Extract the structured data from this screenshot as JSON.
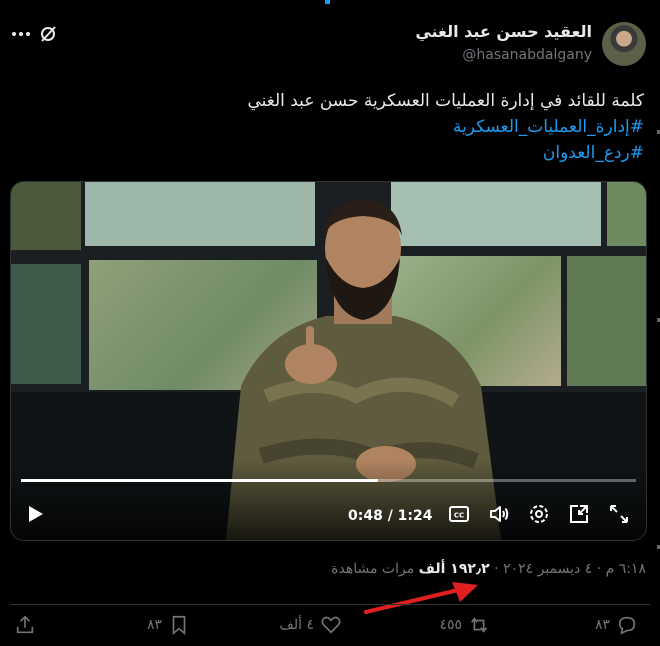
{
  "author": {
    "display_name": "العقيد حسن عبد الغني",
    "handle": "@hasanabdalgany"
  },
  "tweet": {
    "text": "كلمة للقائد في إدارة العمليات العسكرية حسن عبد الغني",
    "hashtags": [
      "#إدارة_العمليات_العسكرية",
      "#ردع_العدوان"
    ]
  },
  "video": {
    "time_display": "0:48 / 1:24",
    "progress_fraction": 0.58
  },
  "meta": {
    "timestamp": "٦:١٨ م · ٤ ديسمبر ٢٠٢٤ ·",
    "views_count": "١٩٢٫٢ ألف",
    "views_label": "مرات مشاهدة"
  },
  "actions": {
    "replies": "٨٣",
    "reposts": "٤٥٥",
    "likes": "٤ ألف",
    "bookmarks": "٨٣"
  },
  "colors": {
    "accent": "#1d9bf0",
    "muted": "#71767b",
    "arrow": "#e02020"
  },
  "icons": [
    "grok-icon",
    "more-icon",
    "play-icon",
    "captions-icon",
    "volume-icon",
    "settings-icon",
    "pip-icon",
    "fullscreen-icon",
    "reply-icon",
    "repost-icon",
    "like-icon",
    "bookmark-icon",
    "share-icon",
    "arrow-annotation"
  ]
}
